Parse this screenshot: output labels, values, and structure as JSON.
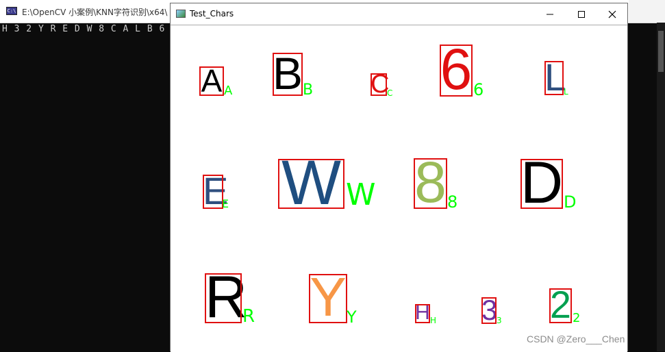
{
  "console": {
    "title": "E:\\OpenCV 小案例\\KNN字符识别\\x64\\",
    "output": "H 3 2 Y R E D W 8 C A L B 6",
    "icon": "console-app-icon"
  },
  "window": {
    "title": "Test_Chars",
    "icon": "image-window-icon",
    "minimize_icon": "minimize-icon",
    "maximize_icon": "maximize-icon",
    "close_icon": "close-icon"
  },
  "chars": [
    {
      "id": "A",
      "glyph": "A",
      "label": "A",
      "color": "#000000"
    },
    {
      "id": "B",
      "glyph": "B",
      "label": "B",
      "color": "#000000"
    },
    {
      "id": "C",
      "glyph": "C",
      "label": "C",
      "color": "#e01010"
    },
    {
      "id": "6",
      "glyph": "6",
      "label": "6",
      "color": "#e01010"
    },
    {
      "id": "L",
      "glyph": "L",
      "label": "L",
      "color": "#2f4f7f"
    },
    {
      "id": "E",
      "glyph": "E",
      "label": "E",
      "color": "#2f4f7f"
    },
    {
      "id": "W",
      "glyph": "W",
      "label": "W",
      "color": "#1f4e80"
    },
    {
      "id": "8",
      "glyph": "8",
      "label": "8",
      "color": "#9bbb59"
    },
    {
      "id": "D",
      "glyph": "D",
      "label": "D",
      "color": "#000000"
    },
    {
      "id": "R",
      "glyph": "R",
      "label": "R",
      "color": "#000000"
    },
    {
      "id": "Y",
      "glyph": "Y",
      "label": "Y",
      "color": "#f79646"
    },
    {
      "id": "H",
      "glyph": "H",
      "label": "H",
      "color": "#7030a0"
    },
    {
      "id": "3",
      "glyph": "3",
      "label": "3",
      "color": "#7030a0"
    },
    {
      "id": "2",
      "glyph": "2",
      "label": "2",
      "color": "#00a050"
    }
  ],
  "watermark": "CSDN @Zero___Chen",
  "colors": {
    "box": "#e01010",
    "label": "#00ff00",
    "console_bg": "#0c0c0c"
  }
}
